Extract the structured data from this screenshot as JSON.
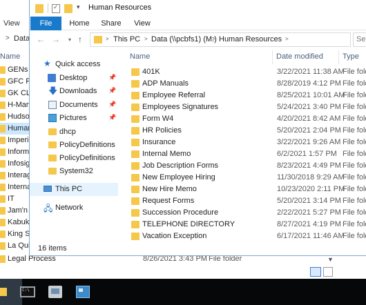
{
  "colors": {
    "accent": "#1979ca",
    "folder": "#f5c84b",
    "selection": "#cce8ff",
    "taskbar": "#060708"
  },
  "background_window": {
    "menu_label": "View",
    "address_text": "Data",
    "column_name": "Name",
    "items": [
      "GENs",
      "GFC Ph",
      "GK CLO",
      "H-Mart",
      "Hudson",
      "Human",
      "Imperis",
      "Informa",
      "Infosigh",
      "Interag",
      "Interna",
      "IT",
      "Jam'n R",
      "Kabuki",
      "King Sp",
      "La Quin"
    ],
    "selected_item": "Human",
    "last_row": {
      "name": "Legal Process",
      "date": "8/26/2021 3:43 PM",
      "type": "File folder"
    }
  },
  "window": {
    "title": "Human Resources",
    "quick_access": [
      "folder-icon",
      "properties-icon",
      "new-folder-icon",
      "customize-dropdown-icon"
    ],
    "ribbon_tabs": [
      "File",
      "Home",
      "Share",
      "View"
    ],
    "breadcrumbs": [
      "This PC",
      "Data (\\\\pcbfs1) (M:)",
      "Human Resources"
    ],
    "search_placeholder": "Sear",
    "nav": {
      "quick_access": "Quick access",
      "pinned": [
        {
          "label": "Desktop",
          "icon": "desktop-icon"
        },
        {
          "label": "Downloads",
          "icon": "downloads-icon"
        },
        {
          "label": "Documents",
          "icon": "documents-icon"
        },
        {
          "label": "Pictures",
          "icon": "pictures-icon"
        }
      ],
      "folders": [
        "dhcp",
        "PolicyDefinitions",
        "PolicyDefinitions",
        "System32"
      ],
      "this_pc": "This PC",
      "network": "Network"
    },
    "columns": {
      "name": "Name",
      "date": "Date modified",
      "type": "Type"
    },
    "files": [
      {
        "name": "401K",
        "date": "3/22/2021 11:38 AM",
        "type": "File fold"
      },
      {
        "name": "ADP Manuals",
        "date": "8/28/2019 4:12 PM",
        "type": "File fold"
      },
      {
        "name": "Employee Referral",
        "date": "8/25/2021 10:01 AM",
        "type": "File fold"
      },
      {
        "name": "Employees Signatures",
        "date": "5/24/2021 3:40 PM",
        "type": "File fold"
      },
      {
        "name": "Form W4",
        "date": "4/20/2021 8:42 AM",
        "type": "File fold"
      },
      {
        "name": "HR Policies",
        "date": "5/20/2021 2:04 PM",
        "type": "File fold"
      },
      {
        "name": "Insurance",
        "date": "3/22/2021 9:26 AM",
        "type": "File fold"
      },
      {
        "name": "Internal Memo",
        "date": "6/2/2021 1:57 PM",
        "type": "File fold"
      },
      {
        "name": "Job Description Forms",
        "date": "8/23/2021 4:49 PM",
        "type": "File fold"
      },
      {
        "name": "New Employee Hiring",
        "date": "11/30/2018 9:29 AM",
        "type": "File fold"
      },
      {
        "name": "New Hire Memo",
        "date": "10/23/2020 2:11 PM",
        "type": "File fold"
      },
      {
        "name": "Request Forms",
        "date": "5/20/2021 3:14 PM",
        "type": "File fold"
      },
      {
        "name": "Succession Procedure",
        "date": "2/22/2021 5:27 PM",
        "type": "File fold"
      },
      {
        "name": "TELEPHONE DIRECTORY",
        "date": "8/27/2021 4:19 PM",
        "type": "File fold"
      },
      {
        "name": "Vacation Exception",
        "date": "6/17/2021 11:46 AM",
        "type": "File fold"
      }
    ],
    "status": "16 items"
  },
  "taskbar": {
    "buttons": [
      "file-explorer-icon",
      "command-prompt-icon",
      "server-manager-icon",
      "control-panel-icon"
    ]
  }
}
